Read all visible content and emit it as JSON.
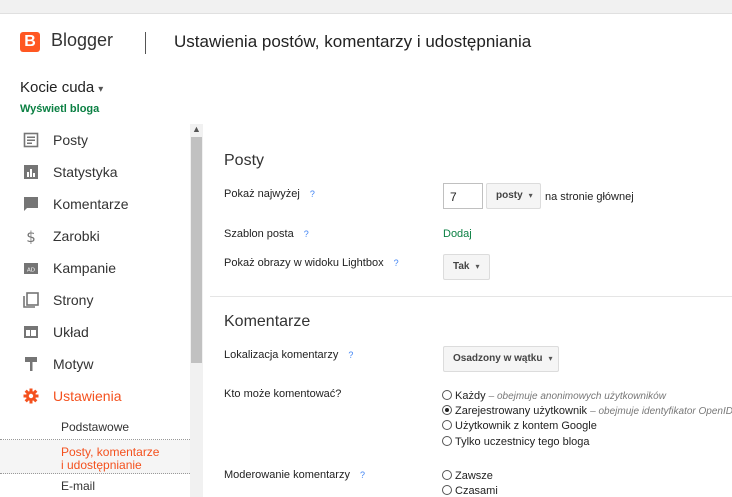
{
  "header": {
    "logo_letter": "B",
    "brand": "Blogger",
    "title": "Ustawienia postów, komentarzy i udostępniania"
  },
  "blog": {
    "name": "Kocie cuda",
    "caret": "▾",
    "view_link": "Wyświetl bloga"
  },
  "sidebar": {
    "items": [
      {
        "label": "Posty",
        "icon": "posts-icon"
      },
      {
        "label": "Statystyka",
        "icon": "stats-icon"
      },
      {
        "label": "Komentarze",
        "icon": "comments-icon"
      },
      {
        "label": "Zarobki",
        "icon": "dollar-icon"
      },
      {
        "label": "Kampanie",
        "icon": "campaigns-icon"
      },
      {
        "label": "Strony",
        "icon": "pages-icon"
      },
      {
        "label": "Układ",
        "icon": "layout-icon"
      },
      {
        "label": "Motyw",
        "icon": "theme-icon"
      },
      {
        "label": "Ustawienia",
        "icon": "gear-icon"
      }
    ],
    "subitems": {
      "basic": "Podstawowe",
      "posts_line1": "Posty, komentarze",
      "posts_line2": "i udostępnianie",
      "email": "E-mail"
    },
    "accent_color": "#f4511e"
  },
  "main": {
    "posts_section": {
      "title": "Posty",
      "show_max_label": "Pokaż najwyżej",
      "show_max_value": "7",
      "unit_select": "posty",
      "unit_suffix": "na stronie głównej",
      "template_label": "Szablon posta",
      "template_action": "Dodaj",
      "lightbox_label": "Pokaż obrazy w widoku Lightbox",
      "lightbox_value": "Tak"
    },
    "comments_section": {
      "title": "Komentarze",
      "location_label": "Lokalizacja komentarzy",
      "location_value": "Osadzony w wątku",
      "who_label": "Kto może komentować?",
      "who_options": [
        {
          "label": "Każdy",
          "desc": "– obejmuje anonimowych użytkowników",
          "selected": false
        },
        {
          "label": "Zarejestrowany użytkownik",
          "desc": "– obejmuje identyfikator OpenID",
          "selected": true
        },
        {
          "label": "Użytkownik z kontem Google",
          "desc": "",
          "selected": false
        },
        {
          "label": "Tylko uczestnicy tego bloga",
          "desc": "",
          "selected": false
        }
      ],
      "moderation_label": "Moderowanie komentarzy",
      "moderation_options": [
        {
          "label": "Zawsze",
          "selected": false
        },
        {
          "label": "Czasami",
          "selected": false
        }
      ]
    },
    "help_glyph": "?",
    "caret_glyph": "▾"
  }
}
